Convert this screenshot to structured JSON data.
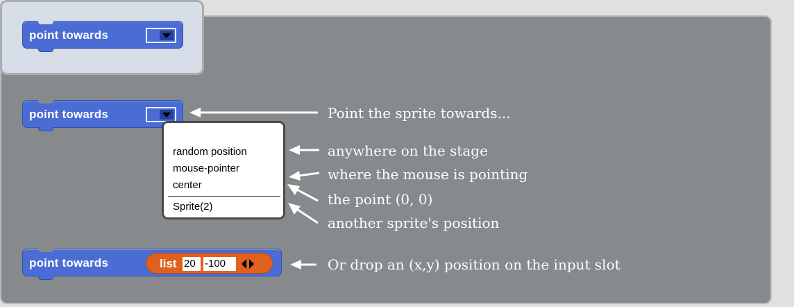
{
  "palette_block": {
    "label": "point towards"
  },
  "block_menu": {
    "label": "point towards"
  },
  "menu": {
    "items": [
      "random position",
      "mouse-pointer",
      "center"
    ],
    "sprite_item": "Sprite(2)"
  },
  "block_list": {
    "label": "point towards",
    "reporter_label": "list",
    "x": "20",
    "y": "-100"
  },
  "annotations": {
    "point_towards": "Point the sprite towards...",
    "random_position": "anywhere on the stage",
    "mouse_pointer": "where the mouse is pointing",
    "center": "the point (0, 0)",
    "sprite": "another sprite's position",
    "input_slot": "Or drop an (x,y) position on the input slot"
  },
  "colors": {
    "block": "#4a6cd4",
    "reporter": "#e0611f",
    "panel": "#868a8c",
    "palette": "#d7dde6"
  }
}
